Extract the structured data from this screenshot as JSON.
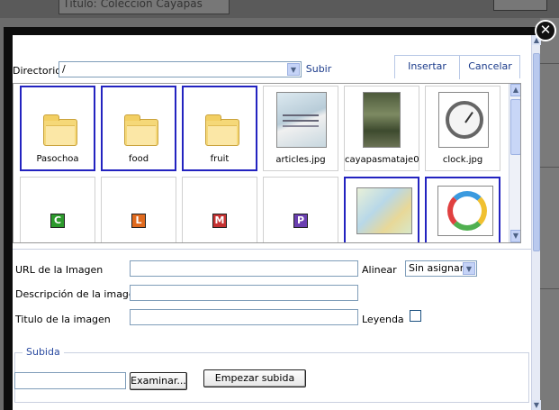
{
  "background": {
    "title_label": "Título:",
    "title_value": "Colección Cayapas"
  },
  "dialog": {
    "close_glyph": "✕",
    "directory": {
      "label": "Directorio",
      "value": "/",
      "up_label": "Subir"
    },
    "actions": {
      "insert_label": "Insertar",
      "cancel_label": "Cancelar"
    },
    "files": [
      {
        "name": "Pasochoa",
        "type": "folder",
        "selected": true
      },
      {
        "name": "food",
        "type": "folder",
        "selected": true
      },
      {
        "name": "fruit",
        "type": "folder",
        "selected": true
      },
      {
        "name": "articles.jpg",
        "type": "image",
        "selected": false
      },
      {
        "name": "cayapasmataje01.j",
        "type": "image",
        "selected": false
      },
      {
        "name": "clock.jpg",
        "type": "image",
        "selected": false
      },
      {
        "letter": "C",
        "type": "letter-icon",
        "color": "#2c9a2c"
      },
      {
        "letter": "L",
        "type": "letter-icon",
        "color": "#e06a1e"
      },
      {
        "letter": "M",
        "type": "letter-icon",
        "color": "#c63232"
      },
      {
        "letter": "P",
        "type": "letter-icon",
        "color": "#6a3fb0"
      },
      {
        "type": "image",
        "selected": true
      },
      {
        "type": "image",
        "selected": true
      }
    ],
    "fields": {
      "url_label": "URL de la Imagen",
      "url_value": "",
      "align_label": "Alinear",
      "align_value": "Sin asignar",
      "desc_label": "Descripción de la imagen",
      "desc_value": "",
      "title_label": "Titulo de la imagen",
      "title_value": "",
      "caption_label": "Leyenda",
      "caption_checked": false
    },
    "upload": {
      "legend": "Subida",
      "browse_label": "Examinar...",
      "start_label": "Empezar subida"
    }
  },
  "colors": {
    "accent": "#1a3a8a",
    "selection_border": "#2323c0",
    "backdrop": "#6b6b6b"
  },
  "icons": [
    "close-icon",
    "dropdown-arrow-icon",
    "folder-icon",
    "scroll-up-icon",
    "scroll-down-icon"
  ]
}
